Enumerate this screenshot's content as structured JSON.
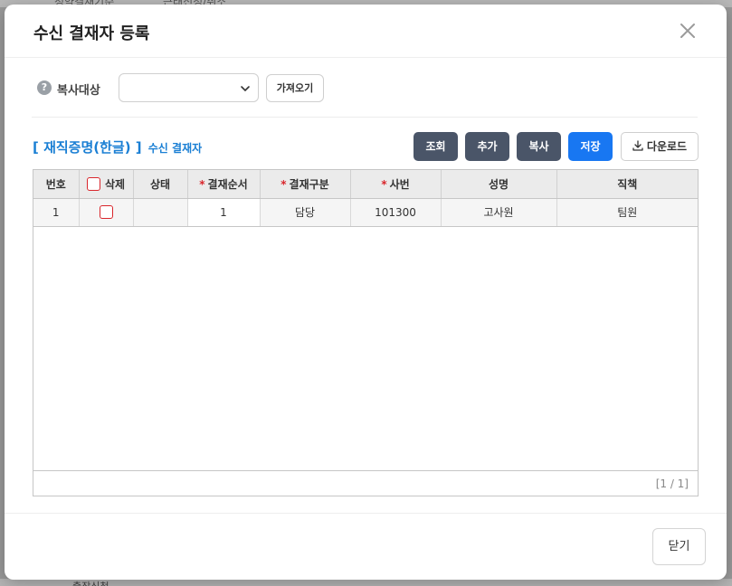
{
  "background": {
    "tab_text_1": "청약결재기준",
    "tab_text_2": "근태신청/취소",
    "bottom_text": "출장신청"
  },
  "modal": {
    "title": "수신 결재자 등록"
  },
  "copy_row": {
    "label": "복사대상",
    "select_value": "",
    "fetch_button": "가져오기"
  },
  "section": {
    "main_title": "[ 재직증명(한글) ]",
    "sub_title": "수신 결재자"
  },
  "toolbar": {
    "inquire": "조회",
    "add": "추가",
    "copy": "복사",
    "save": "저장",
    "download": "다운로드"
  },
  "grid": {
    "headers": {
      "no": "번호",
      "delete": "삭제",
      "status": "상태",
      "order": "결재순서",
      "type": "결재구분",
      "emp_no": "사번",
      "name": "성명",
      "position": "직책"
    },
    "rows": [
      {
        "no": "1",
        "delete": false,
        "status": "",
        "order": "1",
        "type": "담당",
        "emp_no": "101300",
        "name": "고사원",
        "position": "팀원"
      }
    ],
    "pager": "[1 / 1]"
  },
  "footer": {
    "close_button": "닫기"
  },
  "colors": {
    "accent_blue": "#1877f2",
    "section_blue": "#1a7fd4",
    "dark_button": "#4a5568",
    "required_red": "#d9262c"
  }
}
